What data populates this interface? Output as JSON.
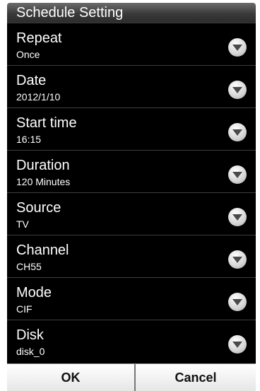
{
  "title": "Schedule Setting",
  "settings": [
    {
      "label": "Repeat",
      "value": "Once"
    },
    {
      "label": "Date",
      "value": "2012/1/10"
    },
    {
      "label": "Start time",
      "value": "16:15"
    },
    {
      "label": "Duration",
      "value": "120 Minutes"
    },
    {
      "label": "Source",
      "value": "TV"
    },
    {
      "label": "Channel",
      "value": "CH55"
    },
    {
      "label": "Mode",
      "value": "CIF"
    },
    {
      "label": "Disk",
      "value": "disk_0"
    }
  ],
  "icons": {
    "dropdown": "chevron-down-icon"
  },
  "buttons": {
    "ok": "OK",
    "cancel": "Cancel"
  }
}
